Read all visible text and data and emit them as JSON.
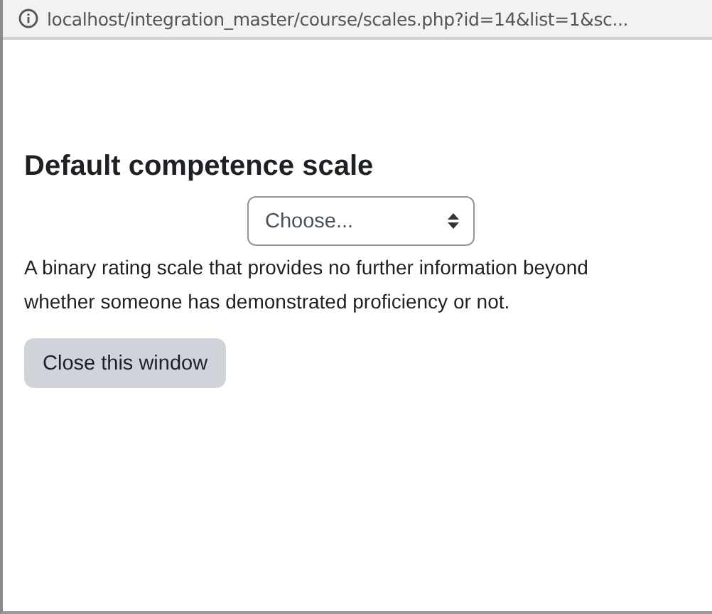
{
  "address_bar": {
    "url": "localhost/integration_master/course/scales.php?id=14&list=1&sc..."
  },
  "heading": "Default competence scale",
  "select": {
    "value": "Choose..."
  },
  "description": "A binary rating scale that provides no further information beyond whether someone has demonstrated proficiency or not.",
  "buttons": [
    "Close this window"
  ]
}
